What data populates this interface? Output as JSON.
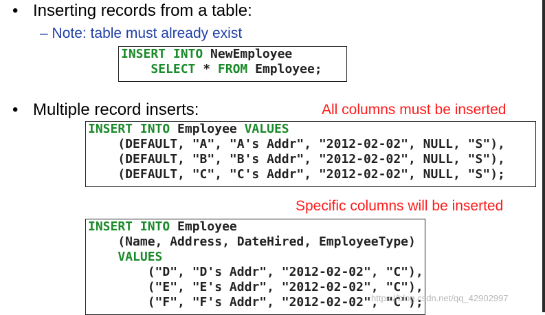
{
  "bullets": [
    {
      "marker": "•",
      "text": "Inserting records from a table:"
    },
    {
      "marker": "•",
      "text": "Multiple record inserts:"
    }
  ],
  "sub_note": {
    "marker": "–",
    "text": "Note: table must already exist"
  },
  "red_notes": {
    "all_columns": "All columns must be inserted",
    "specific_columns": "Specific columns will be inserted"
  },
  "code_blocks": {
    "select_insert": [
      [
        {
          "t": "INSERT INTO",
          "kw": true
        },
        {
          "t": " NewEmployee"
        }
      ],
      [
        {
          "t": "    "
        },
        {
          "t": "SELECT",
          "kw": true
        },
        {
          "t": " * "
        },
        {
          "t": "FROM",
          "kw": true
        },
        {
          "t": " Employee;"
        }
      ]
    ],
    "values_insert": [
      [
        {
          "t": "INSERT INTO",
          "kw": true
        },
        {
          "t": " Employee "
        },
        {
          "t": "VALUES",
          "kw": true
        }
      ],
      [
        {
          "t": "    (DEFAULT, \"A\", \"A's Addr\", \"2012-02-02\", NULL, \"S\"),"
        }
      ],
      [
        {
          "t": "    (DEFAULT, \"B\", \"B's Addr\", \"2012-02-02\", NULL, \"S\"),"
        }
      ],
      [
        {
          "t": "    (DEFAULT, \"C\", \"C's Addr\", \"2012-02-02\", NULL, \"S\");"
        }
      ]
    ],
    "columns_insert": [
      [
        {
          "t": "INSERT INTO",
          "kw": true
        },
        {
          "t": " Employee"
        }
      ],
      [
        {
          "t": "    (Name, Address, DateHired, EmployeeType)"
        }
      ],
      [
        {
          "t": "    "
        },
        {
          "t": "VALUES",
          "kw": true
        }
      ],
      [
        {
          "t": "        (\"D\", \"D's Addr\", \"2012-02-02\", \"C\"),"
        }
      ],
      [
        {
          "t": "        (\"E\", \"E's Addr\", \"2012-02-02\", \"C\"),"
        }
      ],
      [
        {
          "t": "        (\"F\", \"F's Addr\", \"2012-02-02\", \"C\");"
        }
      ]
    ]
  },
  "watermark": "https://blog.csdn.net/qq_42902997",
  "colors": {
    "keyword": "#1a8a2a",
    "note": "#ff1a1a",
    "sub": "#1f3fa6"
  }
}
